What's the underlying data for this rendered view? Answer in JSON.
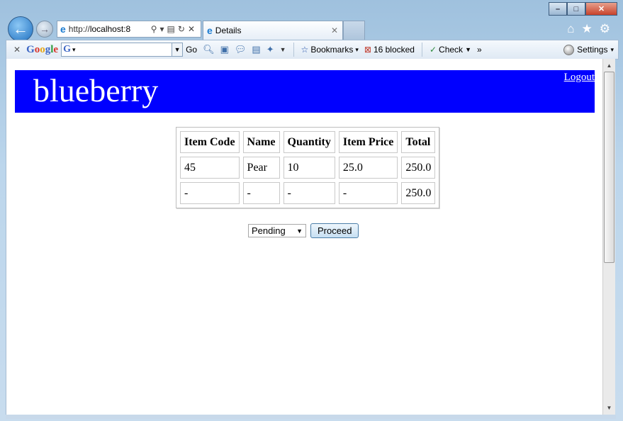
{
  "browser": {
    "url_prefix": "http://",
    "url_host": "localhost:8",
    "tab_title": "Details",
    "go_label": "Go",
    "bookmarks_label": "Bookmarks",
    "blocked_label": "16 blocked",
    "check_label": "Check",
    "settings_label": "Settings",
    "more_label": "»"
  },
  "page": {
    "brand": "blueberry",
    "logout": "Logout",
    "table": {
      "headers": [
        "Item Code",
        "Name",
        "Quantity",
        "Item Price",
        "Total"
      ],
      "rows": [
        [
          "45",
          "Pear",
          "10",
          "25.0",
          "250.0"
        ],
        [
          "-",
          "-",
          "-",
          "-",
          "250.0"
        ]
      ]
    },
    "status_select": {
      "selected": "Pending"
    },
    "proceed_label": "Proceed"
  }
}
